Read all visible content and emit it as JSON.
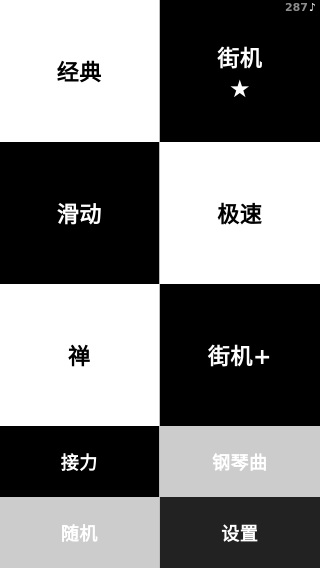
{
  "status": {
    "score": "287",
    "note_icon": "music-note-icon"
  },
  "tiles": {
    "classic": "经典",
    "arcade": "街机",
    "arcade_star": "★",
    "slide": "滑动",
    "speed": "极速",
    "zen": "禅",
    "arcade_plus": "街机+",
    "relay": "接力",
    "piano": "钢琴曲",
    "random": "随机",
    "settings": "设置"
  },
  "colors": {
    "white_tile": "#ffffff",
    "black_tile": "#000000",
    "gray_tile": "#cccccc",
    "dark_tile": "#222222"
  }
}
